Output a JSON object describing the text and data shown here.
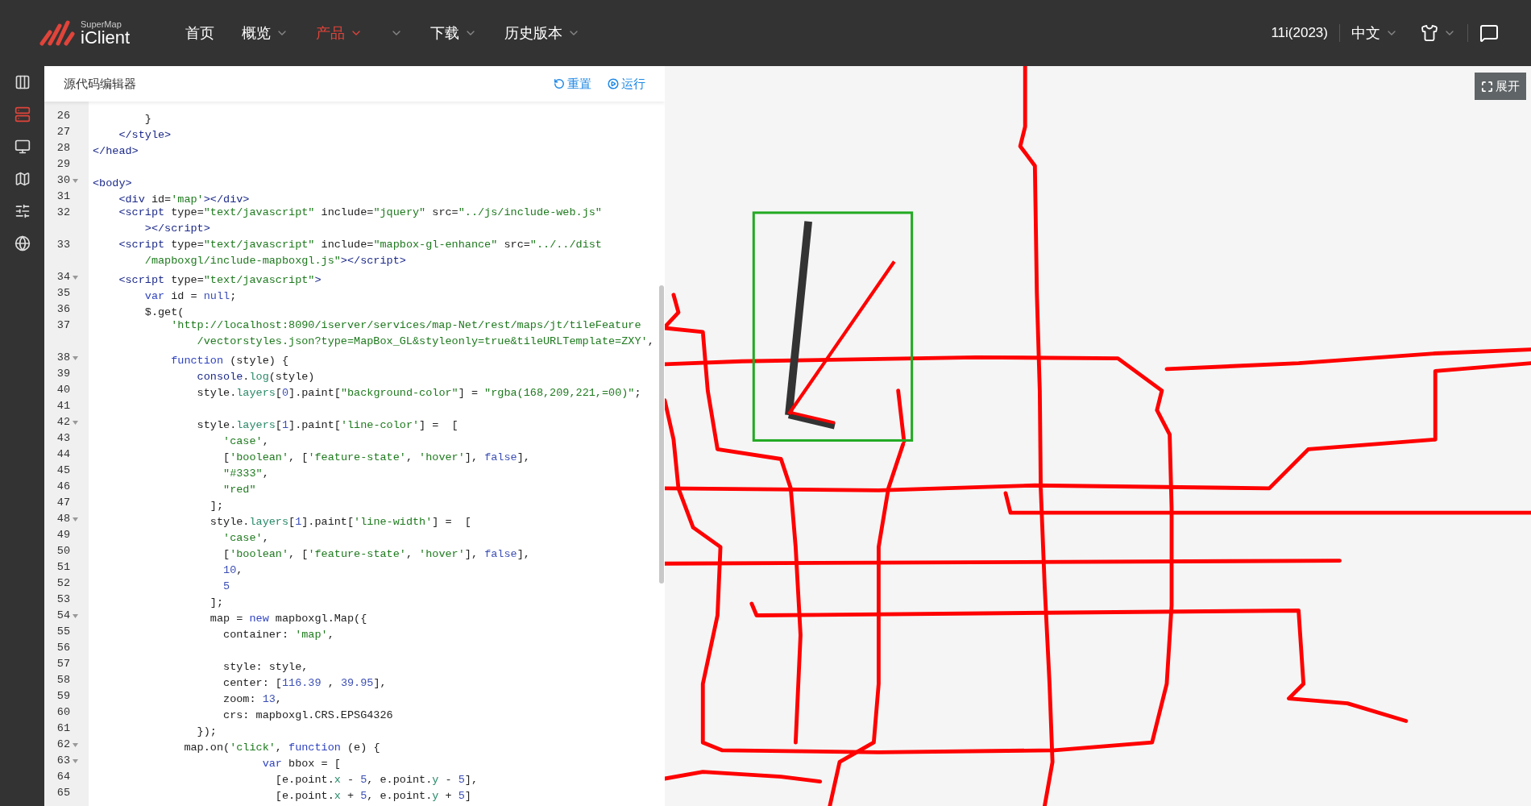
{
  "header": {
    "logo": {
      "small": "SuperMap",
      "name": "iClient"
    },
    "nav": [
      {
        "label": "首页",
        "selected": false,
        "has_menu": false
      },
      {
        "label": "概览",
        "selected": false,
        "has_menu": true
      },
      {
        "label": "产品",
        "selected": true,
        "has_menu": true
      },
      {
        "selected": false,
        "has_menu": true
      },
      {
        "label": "下载",
        "selected": false,
        "has_menu": true
      },
      {
        "label": "历史版本",
        "selected": false,
        "has_menu": true
      }
    ],
    "version": "11i(2023)",
    "language": "中文"
  },
  "sidebar": {
    "items": [
      {
        "kind": "columns",
        "selected": false
      },
      {
        "kind": "list",
        "selected": true
      },
      {
        "kind": "monitor",
        "selected": false
      },
      {
        "kind": "map",
        "selected": false
      },
      {
        "kind": "sliders",
        "selected": false
      },
      {
        "kind": "globe",
        "selected": false
      }
    ]
  },
  "editor": {
    "title": "源代码编辑器",
    "buttons": [
      {
        "kind": "reset",
        "label": "重置"
      },
      {
        "kind": "run",
        "label": "运行"
      }
    ],
    "lines": [
      {
        "number": "26",
        "parts": [
          {
            "kind": "p",
            "text": "        }"
          }
        ]
      },
      {
        "number": "27",
        "parts": [
          {
            "kind": "tag",
            "text": "    </style>"
          }
        ]
      },
      {
        "number": "28",
        "parts": [
          {
            "kind": "tag",
            "text": "</head>"
          }
        ]
      },
      {
        "number": "29"
      },
      {
        "number": "30",
        "fold": true,
        "parts": [
          {
            "kind": "tag",
            "text": "<body>"
          }
        ]
      },
      {
        "number": "31",
        "parts": [
          {
            "kind": "tag",
            "text": "    <div"
          },
          {
            "kind": "attr",
            "text": " id="
          },
          {
            "kind": "str",
            "text": "'map'"
          },
          {
            "kind": "tag",
            "text": "></div>"
          }
        ]
      },
      {
        "number": "32",
        "parts": [
          {
            "kind": "tag",
            "text": "    <script"
          },
          {
            "kind": "attr",
            "text": " type="
          },
          {
            "kind": "str",
            "text": "\"text/javascript\""
          },
          {
            "kind": "attr",
            "text": " include="
          },
          {
            "kind": "str",
            "text": "\"jquery\""
          },
          {
            "kind": "attr",
            "text": " src="
          },
          {
            "kind": "str",
            "text": "\"../js/include-web.js\""
          }
        ],
        "wrap": [
          {
            "kind": "tag",
            "text": "        ></script>"
          }
        ]
      },
      {
        "number": "33",
        "parts": [
          {
            "kind": "tag",
            "text": "    <script"
          },
          {
            "kind": "attr",
            "text": " type="
          },
          {
            "kind": "str",
            "text": "\"text/javascript\""
          },
          {
            "kind": "attr",
            "text": " include="
          },
          {
            "kind": "str",
            "text": "\"mapbox-gl-enhance\""
          },
          {
            "kind": "attr",
            "text": " src="
          },
          {
            "kind": "str",
            "text": "\"../../dist"
          }
        ],
        "wrap": [
          {
            "kind": "str",
            "text": "        /mapboxgl/include-mapboxgl.js\""
          },
          {
            "kind": "tag",
            "text": "></script>"
          }
        ]
      },
      {
        "number": "34",
        "fold": true,
        "parts": [
          {
            "kind": "tag",
            "text": "    <script"
          },
          {
            "kind": "attr",
            "text": " type="
          },
          {
            "kind": "str",
            "text": "\"text/javascript\""
          },
          {
            "kind": "tag",
            "text": ">"
          }
        ]
      },
      {
        "number": "35",
        "parts": [
          {
            "kind": "kw",
            "text": "        var"
          },
          {
            "kind": "p",
            "text": " id = "
          },
          {
            "kind": "num",
            "text": "null"
          },
          {
            "kind": "p",
            "text": ";"
          }
        ]
      },
      {
        "number": "36",
        "parts": [
          {
            "kind": "p",
            "text": "        $.get("
          }
        ]
      },
      {
        "number": "37",
        "parts": [
          {
            "kind": "str",
            "text": "            'http://localhost:8090/iserver/services/map-Net/rest/maps/jt/tileFeature"
          }
        ],
        "wrap": [
          {
            "kind": "str",
            "text": "                /vectorstyles.json?type=MapBox_GL&styleonly=true&tileURLTemplate=ZXY'"
          },
          {
            "kind": "p",
            "text": ","
          }
        ]
      },
      {
        "number": "38",
        "fold": true,
        "parts": [
          {
            "kind": "kw",
            "text": "            function"
          },
          {
            "kind": "p",
            "text": " (style) {"
          }
        ]
      },
      {
        "number": "39",
        "parts": [
          {
            "kind": "kw2",
            "text": "                console"
          },
          {
            "kind": "p",
            "text": "."
          },
          {
            "kind": "prop",
            "text": "log"
          },
          {
            "kind": "p",
            "text": "(style)"
          }
        ]
      },
      {
        "number": "40",
        "parts": [
          {
            "kind": "p",
            "text": "                style."
          },
          {
            "kind": "prop",
            "text": "layers"
          },
          {
            "kind": "p",
            "text": "["
          },
          {
            "kind": "num",
            "text": "0"
          },
          {
            "kind": "p",
            "text": "].paint["
          },
          {
            "kind": "str",
            "text": "\"background-color\""
          },
          {
            "kind": "p",
            "text": "] = "
          },
          {
            "kind": "str",
            "text": "\"rgba(168,209,221,=00)\""
          },
          {
            "kind": "p",
            "text": ";"
          }
        ]
      },
      {
        "number": "41"
      },
      {
        "number": "42",
        "fold": true,
        "parts": [
          {
            "kind": "p",
            "text": "                style."
          },
          {
            "kind": "prop",
            "text": "layers"
          },
          {
            "kind": "p",
            "text": "["
          },
          {
            "kind": "num",
            "text": "1"
          },
          {
            "kind": "p",
            "text": "].paint["
          },
          {
            "kind": "str",
            "text": "'line-color'"
          },
          {
            "kind": "p",
            "text": "] =  ["
          }
        ]
      },
      {
        "number": "43",
        "parts": [
          {
            "kind": "str",
            "text": "                    'case'"
          },
          {
            "kind": "p",
            "text": ","
          }
        ]
      },
      {
        "number": "44",
        "parts": [
          {
            "kind": "p",
            "text": "                    ["
          },
          {
            "kind": "str",
            "text": "'boolean'"
          },
          {
            "kind": "p",
            "text": ", ["
          },
          {
            "kind": "str",
            "text": "'feature-state'"
          },
          {
            "kind": "p",
            "text": ", "
          },
          {
            "kind": "str",
            "text": "'hover'"
          },
          {
            "kind": "p",
            "text": "], "
          },
          {
            "kind": "num",
            "text": "false"
          },
          {
            "kind": "p",
            "text": "],"
          }
        ]
      },
      {
        "number": "45",
        "parts": [
          {
            "kind": "str",
            "text": "                    \"#333\""
          },
          {
            "kind": "p",
            "text": ","
          }
        ]
      },
      {
        "number": "46",
        "parts": [
          {
            "kind": "str",
            "text": "                    \"red\""
          }
        ]
      },
      {
        "number": "47",
        "parts": [
          {
            "kind": "p",
            "text": "                  ];"
          }
        ]
      },
      {
        "number": "48",
        "fold": true,
        "parts": [
          {
            "kind": "p",
            "text": "                  style."
          },
          {
            "kind": "prop",
            "text": "layers"
          },
          {
            "kind": "p",
            "text": "["
          },
          {
            "kind": "num",
            "text": "1"
          },
          {
            "kind": "p",
            "text": "].paint["
          },
          {
            "kind": "str",
            "text": "'line-width'"
          },
          {
            "kind": "p",
            "text": "] =  ["
          }
        ]
      },
      {
        "number": "49",
        "parts": [
          {
            "kind": "str",
            "text": "                    'case'"
          },
          {
            "kind": "p",
            "text": ","
          }
        ]
      },
      {
        "number": "50",
        "parts": [
          {
            "kind": "p",
            "text": "                    ["
          },
          {
            "kind": "str",
            "text": "'boolean'"
          },
          {
            "kind": "p",
            "text": ", ["
          },
          {
            "kind": "str",
            "text": "'feature-state'"
          },
          {
            "kind": "p",
            "text": ", "
          },
          {
            "kind": "str",
            "text": "'hover'"
          },
          {
            "kind": "p",
            "text": "], "
          },
          {
            "kind": "num",
            "text": "false"
          },
          {
            "kind": "p",
            "text": "],"
          }
        ]
      },
      {
        "number": "51",
        "parts": [
          {
            "kind": "num",
            "text": "                    10"
          },
          {
            "kind": "p",
            "text": ","
          }
        ]
      },
      {
        "number": "52",
        "parts": [
          {
            "kind": "num",
            "text": "                    5"
          }
        ]
      },
      {
        "number": "53",
        "parts": [
          {
            "kind": "p",
            "text": "                  ];"
          }
        ]
      },
      {
        "number": "54",
        "fold": true,
        "parts": [
          {
            "kind": "p",
            "text": "                  map = "
          },
          {
            "kind": "kw",
            "text": "new"
          },
          {
            "kind": "p",
            "text": " mapboxgl.Map({"
          }
        ]
      },
      {
        "number": "55",
        "parts": [
          {
            "kind": "p",
            "text": "                    container: "
          },
          {
            "kind": "str",
            "text": "'map'"
          },
          {
            "kind": "p",
            "text": ","
          }
        ]
      },
      {
        "number": "56"
      },
      {
        "number": "57",
        "parts": [
          {
            "kind": "p",
            "text": "                    style: style,"
          }
        ]
      },
      {
        "number": "58",
        "parts": [
          {
            "kind": "p",
            "text": "                    center: ["
          },
          {
            "kind": "num",
            "text": "116.39"
          },
          {
            "kind": "p",
            "text": " , "
          },
          {
            "kind": "num",
            "text": "39.95"
          },
          {
            "kind": "p",
            "text": "],"
          }
        ]
      },
      {
        "number": "59",
        "parts": [
          {
            "kind": "p",
            "text": "                    zoom: "
          },
          {
            "kind": "num",
            "text": "13"
          },
          {
            "kind": "p",
            "text": ","
          }
        ]
      },
      {
        "number": "60",
        "parts": [
          {
            "kind": "p",
            "text": "                    crs: mapboxgl.CRS.EPSG4326"
          }
        ]
      },
      {
        "number": "61",
        "parts": [
          {
            "kind": "p",
            "text": "                });"
          }
        ]
      },
      {
        "number": "62",
        "fold": true,
        "parts": [
          {
            "kind": "p",
            "text": "              map.on("
          },
          {
            "kind": "str",
            "text": "'click'"
          },
          {
            "kind": "p",
            "text": ", "
          },
          {
            "kind": "kw",
            "text": "function"
          },
          {
            "kind": "p",
            "text": " (e) {"
          }
        ]
      },
      {
        "number": "63",
        "fold": true,
        "parts": [
          {
            "kind": "kw",
            "text": "                          var"
          },
          {
            "kind": "p",
            "text": " bbox = ["
          }
        ]
      },
      {
        "number": "64",
        "parts": [
          {
            "kind": "p",
            "text": "                            [e.point."
          },
          {
            "kind": "prop",
            "text": "x"
          },
          {
            "kind": "p",
            "text": " - "
          },
          {
            "kind": "num",
            "text": "5"
          },
          {
            "kind": "p",
            "text": ", e.point."
          },
          {
            "kind": "prop",
            "text": "y"
          },
          {
            "kind": "p",
            "text": " - "
          },
          {
            "kind": "num",
            "text": "5"
          },
          {
            "kind": "p",
            "text": "],"
          }
        ]
      },
      {
        "number": "65",
        "parts": [
          {
            "kind": "p",
            "text": "                            [e.point."
          },
          {
            "kind": "prop",
            "text": "x"
          },
          {
            "kind": "p",
            "text": " + "
          },
          {
            "kind": "num",
            "text": "5"
          },
          {
            "kind": "p",
            "text": ", e.point."
          },
          {
            "kind": "prop",
            "text": "y"
          },
          {
            "kind": "p",
            "text": " + "
          },
          {
            "kind": "num",
            "text": "5"
          },
          {
            "kind": "p",
            "text": "]"
          }
        ]
      }
    ]
  },
  "map": {
    "expand_button": "展开"
  }
}
